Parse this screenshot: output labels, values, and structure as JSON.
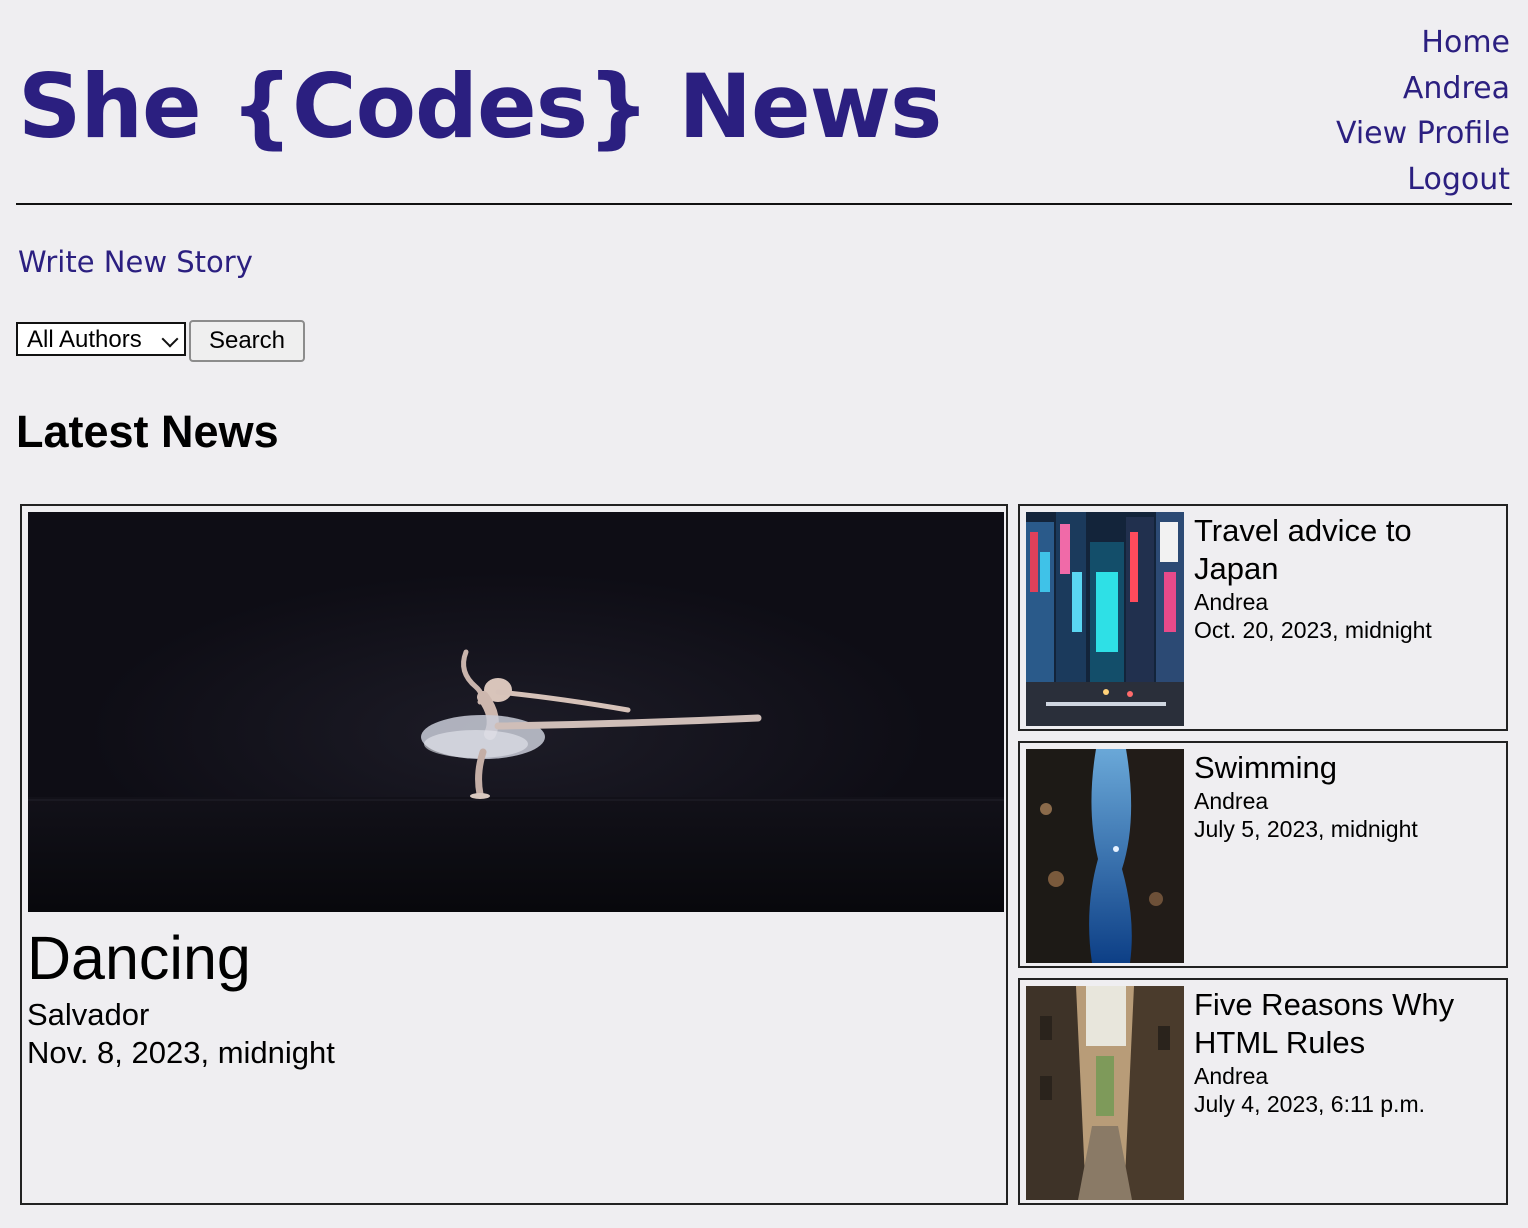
{
  "header": {
    "site_title": "She {Codes} News",
    "nav": [
      "Home",
      "Andrea",
      "View Profile",
      "Logout"
    ]
  },
  "write_story_label": "Write New Story",
  "filter": {
    "author_selected": "All Authors",
    "search_label": "Search"
  },
  "section_title": "Latest News",
  "featured": {
    "title": "Dancing",
    "author": "Salvador",
    "date": "Nov. 8, 2023, midnight"
  },
  "stories": [
    {
      "title": "Travel advice to Japan",
      "author": "Andrea",
      "date": "Oct. 20, 2023, midnight"
    },
    {
      "title": "Swimming",
      "author": "Andrea",
      "date": "July 5, 2023, midnight"
    },
    {
      "title": "Five Reasons Why HTML Rules",
      "author": "Andrea",
      "date": "July 4, 2023, 6:11 p.m."
    }
  ],
  "colors": {
    "page_background": "#efeef1",
    "brand": "#2b1f80"
  }
}
